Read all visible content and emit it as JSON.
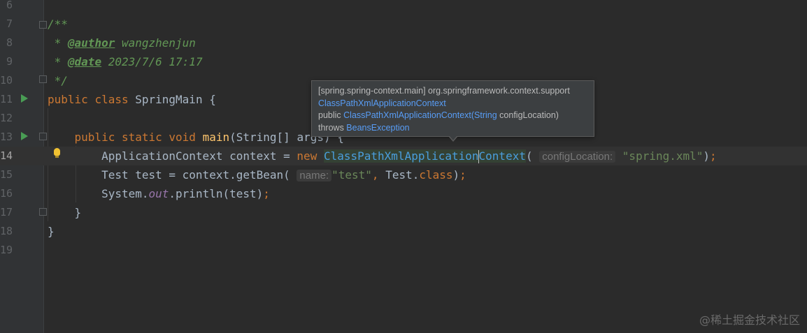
{
  "editor": {
    "lines": [
      {
        "num": "6"
      },
      {
        "num": "7"
      },
      {
        "num": "8"
      },
      {
        "num": "9"
      },
      {
        "num": "10"
      },
      {
        "num": "11"
      },
      {
        "num": "12"
      },
      {
        "num": "13"
      },
      {
        "num": "14"
      },
      {
        "num": "15"
      },
      {
        "num": "16"
      },
      {
        "num": "17"
      },
      {
        "num": "18"
      },
      {
        "num": "19"
      }
    ],
    "l7": {
      "text": "/**"
    },
    "l8": {
      "star": " * ",
      "tag": "@author",
      "value": " wangzhenjun"
    },
    "l9": {
      "star": " * ",
      "tag": "@date",
      "value": " 2023/7/6 17:17"
    },
    "l10": {
      "text": " */"
    },
    "l11": {
      "kw1": "public",
      "kw2": "class",
      "name": " SpringMain {"
    },
    "l13": {
      "indent": "    ",
      "kw1": "public",
      "kw2": "static",
      "kw3": "void",
      "fn": "main",
      "rest": "(String[] args) {"
    },
    "l14": {
      "indent": "        ",
      "type": "ApplicationContext",
      "var": " context = ",
      "kw": "new",
      "cls1": "ClassPathXmlApplication",
      "cls2": "Context",
      "open": "(",
      "hint": "configLocation:",
      "str": "\"spring.xml\"",
      "close": ")",
      "semi": ";"
    },
    "l15": {
      "indent": "        ",
      "pre": "Test test = context.getBean(",
      "hint": "name:",
      "str": "\"test\"",
      "comma": ",",
      "mid": " Test.",
      "kw": "class",
      "close": ")",
      "semi": ";"
    },
    "l16": {
      "indent": "        ",
      "pre": "System.",
      "field": "out",
      "rest": ".println(test)",
      "semi": ";"
    },
    "l17": {
      "text": "    }"
    },
    "l18": {
      "text": "}"
    }
  },
  "tooltip": {
    "line1": "[spring.spring-context.main] org.springframework.context.support",
    "line2": "ClassPathXmlApplicationContext",
    "line3_pre": "public ",
    "line3_link": "ClassPathXmlApplicationContext",
    "line3_paren": "(",
    "line3_type": "String",
    "line3_rest": " configLocation)",
    "line4_pre": "throws ",
    "line4_link": "BeansException"
  },
  "watermark": "@稀土掘金技术社区"
}
